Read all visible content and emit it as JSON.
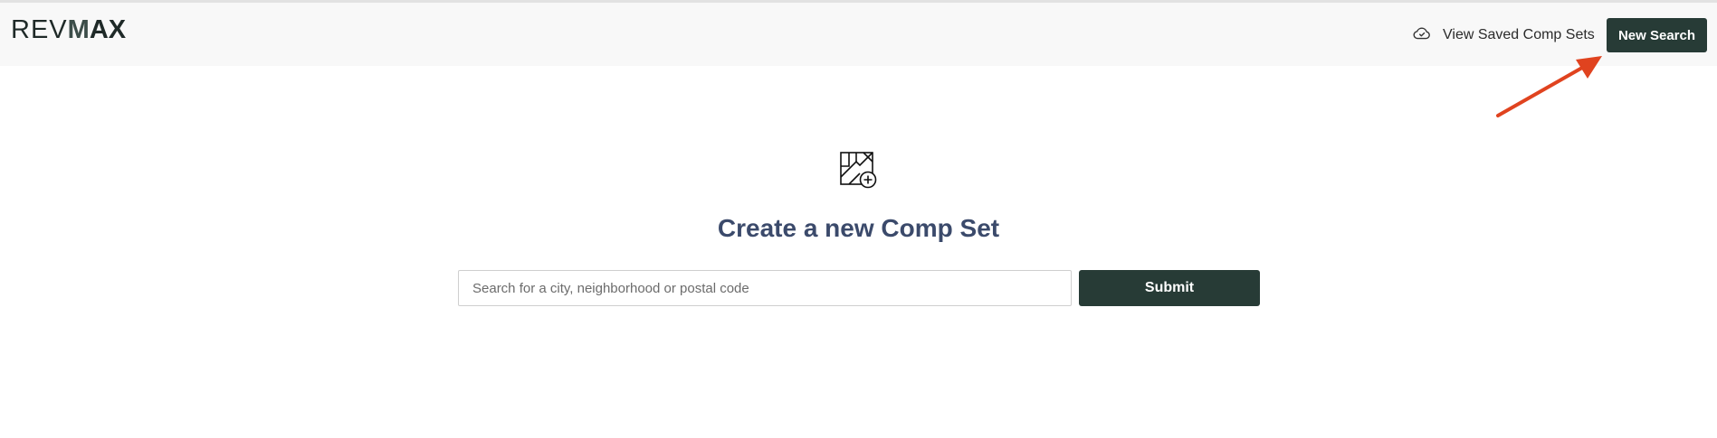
{
  "header": {
    "logo_part1": "REV",
    "logo_part2_m": "M",
    "logo_part2_ax": "AX",
    "saved_link_label": "View Saved Comp Sets",
    "saved_link_icon": "cloud-check-icon",
    "new_search_label": "New Search"
  },
  "main": {
    "icon": "map-add-icon",
    "title": "Create a new Comp Set",
    "search": {
      "placeholder": "Search for a city, neighborhood or postal code",
      "value": ""
    },
    "submit_label": "Submit"
  },
  "annotation": {
    "arrow_color": "#e0431f"
  },
  "colors": {
    "accent": "#273b36",
    "title": "#3b4a6b",
    "header_bg": "#f8f8f8"
  }
}
